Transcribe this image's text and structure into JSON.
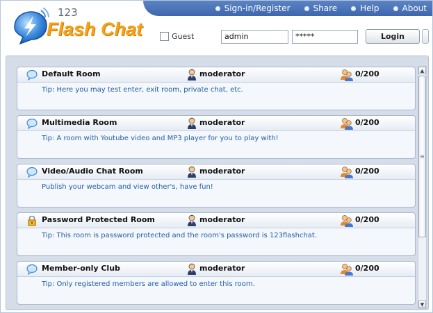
{
  "header": {
    "logo": {
      "prefix": "123",
      "name": "Flash Chat"
    },
    "nav": [
      {
        "label": "Sign-in/Register"
      },
      {
        "label": "Share"
      },
      {
        "label": "Help"
      },
      {
        "label": "About"
      }
    ],
    "login": {
      "guest_label": "Guest",
      "guest_checked": false,
      "username_value": "admin",
      "password_value": "*****",
      "login_label": "Login"
    }
  },
  "rooms": [
    {
      "name": "Default Room",
      "moderator": "moderator",
      "count": "0/200",
      "tip": "Tip: Here you may test enter, exit room, private chat, etc.",
      "icon": "chat-bubble-icon"
    },
    {
      "name": "Multimedia Room",
      "moderator": "moderator",
      "count": "0/200",
      "tip": "Tip: A room with Youtube video and MP3 player for you to play with!",
      "icon": "chat-bubble-icon"
    },
    {
      "name": "Video/Audio Chat Room",
      "moderator": "moderator",
      "count": "0/200",
      "tip": "Publish your webcam and view other's, have fun!",
      "icon": "chat-bubble-icon"
    },
    {
      "name": "Password Protected Room",
      "moderator": "moderator",
      "count": "0/200",
      "tip": "Tip: This room is password protected and the room's password is 123flashchat.",
      "icon": "lock-icon"
    },
    {
      "name": "Member-only Club",
      "moderator": "moderator",
      "count": "0/200",
      "tip": "Tip: Only registered members are allowed to enter this room.",
      "icon": "chat-bubble-icon"
    }
  ],
  "colors": {
    "accent_blue": "#3f66ad",
    "logo_orange": "#f4a21a",
    "tip_blue": "#1f5ea8",
    "panel_bg": "#d5dde9"
  }
}
